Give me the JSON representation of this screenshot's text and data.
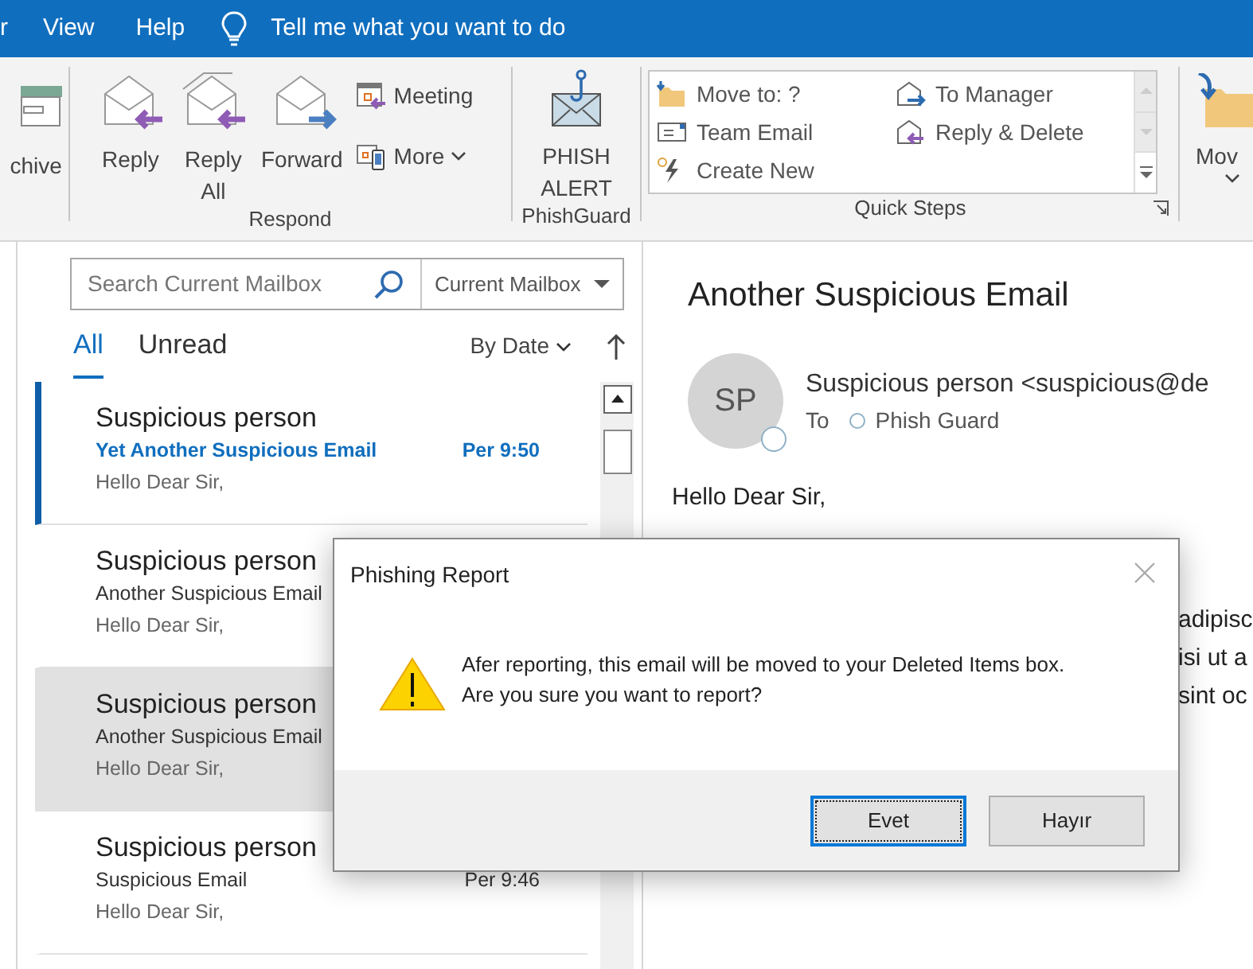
{
  "menu_bar": {
    "items": [
      "r",
      "View",
      "Help"
    ],
    "tell_me": "Tell me what you want to do"
  },
  "ribbon": {
    "archive": {
      "label": "chive"
    },
    "respond": {
      "title": "Respond",
      "large_buttons": [
        "Reply",
        "Reply All",
        "Forward"
      ],
      "small_buttons": [
        {
          "label": "Meeting",
          "dropdown": false
        },
        {
          "label": "More",
          "dropdown": true
        }
      ]
    },
    "phishguard": {
      "title": "PhishGuard",
      "button": "PHISH ALERT"
    },
    "quick_steps": {
      "title": "Quick Steps",
      "items": [
        "Move to: ?",
        "Team Email",
        "Create New",
        "To Manager",
        "Reply & Delete"
      ]
    },
    "move": {
      "label": "Mov"
    }
  },
  "search": {
    "placeholder": "Search Current Mailbox",
    "scope": "Current Mailbox"
  },
  "filters": [
    {
      "label": "All",
      "selected": true
    },
    {
      "label": "Unread",
      "selected": false
    }
  ],
  "sort": {
    "label": "By Date"
  },
  "messages": [
    {
      "sender": "Suspicious person",
      "subject": "Yet Another Suspicious Email",
      "time": "Per 9:50",
      "preview": "Hello Dear Sir,",
      "unread": true,
      "selected": false
    },
    {
      "sender": "Suspicious person",
      "subject": "Another Suspicious Email",
      "preview": "Hello Dear Sir,",
      "unread": false,
      "selected": false
    },
    {
      "sender": "Suspicious person",
      "subject": "Another Suspicious Email",
      "preview": "Hello Dear Sir,",
      "unread": false,
      "selected": true
    },
    {
      "sender": "Suspicious person",
      "subject": "Suspicious Email",
      "time": "Per 9:46",
      "preview": "Hello Dear Sir,",
      "unread": false,
      "selected": false
    }
  ],
  "reading_pane": {
    "subject": "Another Suspicious Email",
    "avatar": "SP",
    "from": "Suspicious person <suspicious@de",
    "to_label": "To",
    "recipient": "Phish Guard",
    "greeting": "Hello Dear Sir,",
    "body_fragments": [
      "adipisc",
      "isi ut a",
      "sint oc"
    ]
  },
  "dialog": {
    "title": "Phishing Report",
    "message": [
      "Afer reporting, this email will be moved to your Deleted Items box.",
      "Are you sure you want to report?"
    ],
    "buttons": [
      {
        "label": "Evet",
        "focused": true
      },
      {
        "label": "Hayır",
        "focused": false
      }
    ]
  }
}
